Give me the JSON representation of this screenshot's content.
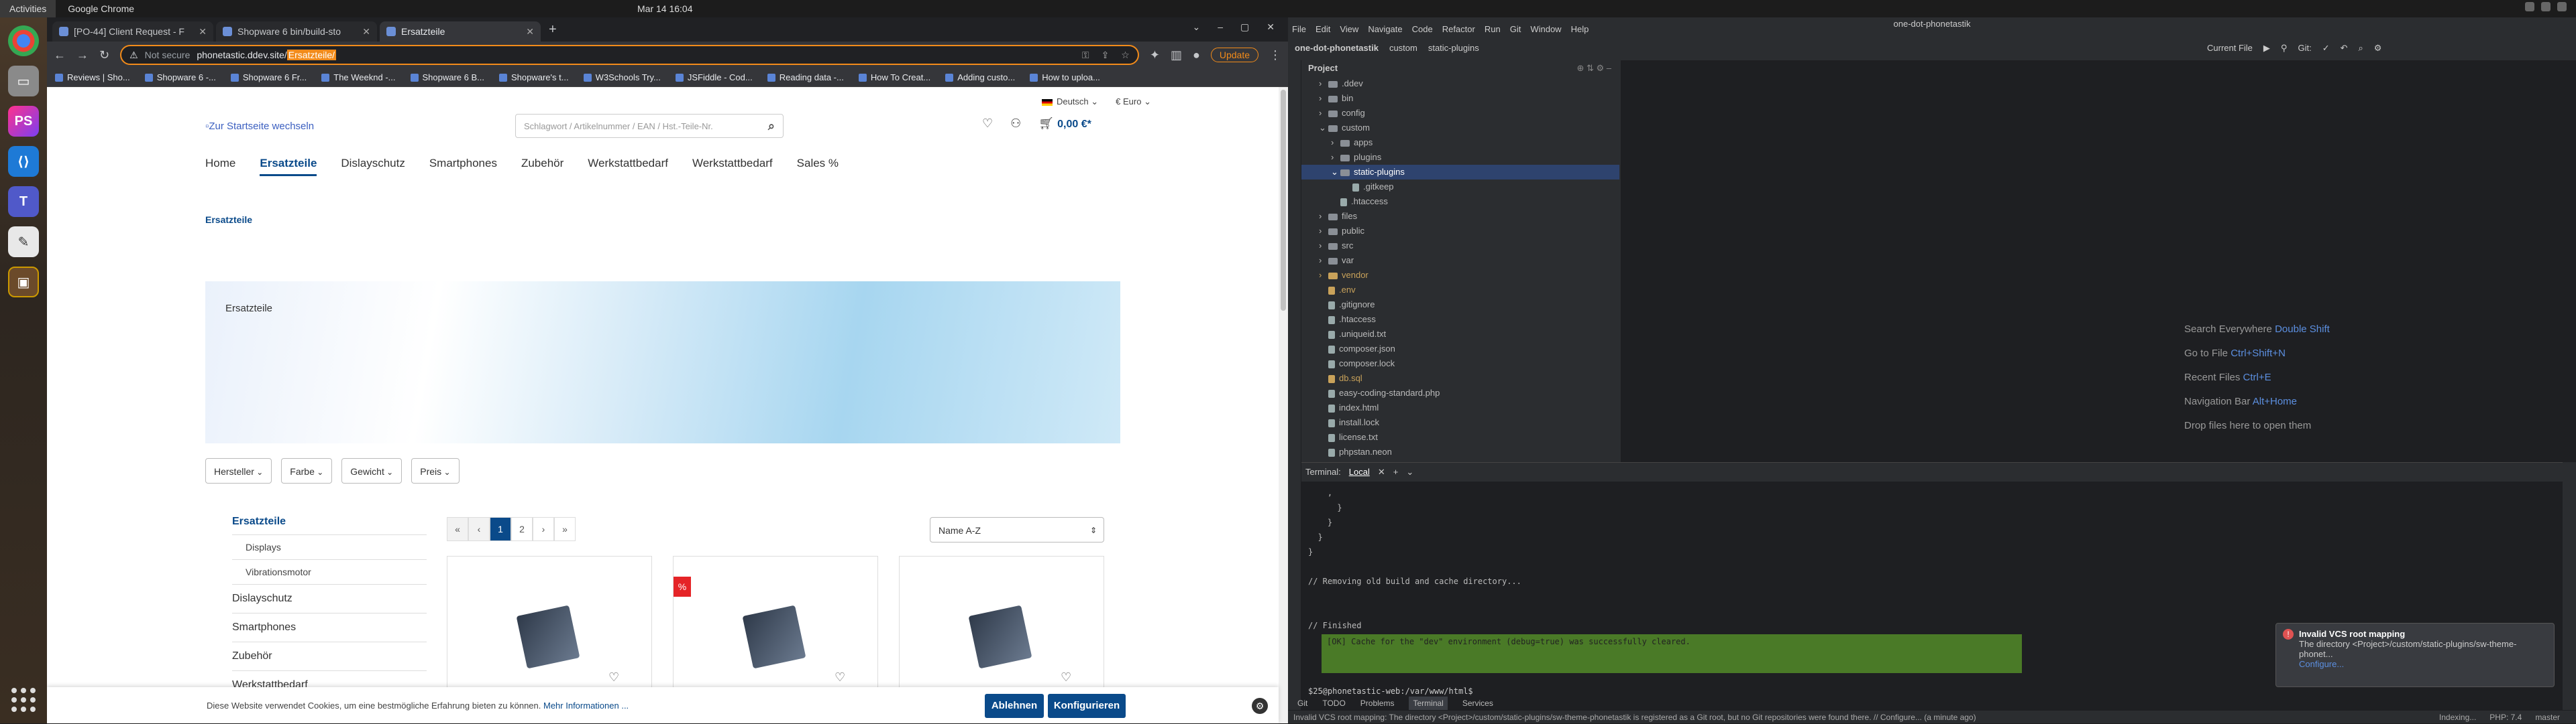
{
  "system": {
    "activities": "Activities",
    "app": "Google Chrome",
    "clock": "Mar 14  16:04"
  },
  "browser": {
    "tabs": [
      {
        "label": "[PO-44] Client Request - F"
      },
      {
        "label": "Shopware 6 bin/build-sto"
      },
      {
        "label": "Ersatzteile"
      }
    ],
    "not_secure": "Not secure",
    "url_host": "phonetastic.ddev.site/",
    "url_path": "Ersatzteile/",
    "update_label": "Update",
    "bookmarks": [
      "Reviews | Sho...",
      "Shopware 6 -...",
      "Shopware 6 Fr...",
      "The Weeknd -...",
      "Shopware 6 B...",
      "Shopware's t...",
      "W3Schools Try...",
      "JSFiddle - Cod...",
      "Reading data -...",
      "How To Creat...",
      "Adding custo...",
      "How to uploa..."
    ]
  },
  "shop": {
    "language": "Deutsch",
    "currency": "€ Euro",
    "logo_alt": "Zur Startseite wechseln",
    "search_placeholder": "Schlagwort / Artikelnummer / EAN / Hst.-Teile-Nr.",
    "cart_total": "0,00 €*",
    "nav": [
      "Home",
      "Ersatzteile",
      "Dislayschutz",
      "Smartphones",
      "Zubehör",
      "Werkstattbedarf",
      "Werkstattbedarf",
      "Sales %"
    ],
    "breadcrumb": "Ersatzteile",
    "hero_title": "Ersatzteile",
    "filters": [
      "Hersteller",
      "Farbe",
      "Gewicht",
      "Preis"
    ],
    "sidebar": {
      "active": "Ersatzteile",
      "subs": [
        "Displays",
        "Vibrationsmotor"
      ],
      "items": [
        "Dislayschutz",
        "Smartphones",
        "Zubehör",
        "Werkstattbedarf"
      ]
    },
    "pagination": [
      "«",
      "‹",
      "1",
      "2",
      "›",
      "»"
    ],
    "sort": "Name A-Z",
    "sale_badge": "%",
    "cookie_text": "Diese Website verwendet Cookies, um eine bestmögliche Erfahrung bieten zu können.",
    "cookie_link": "Mehr Informationen ...",
    "cookie_reject": "Ablehnen",
    "cookie_configure": "Konfigurieren"
  },
  "ide": {
    "title": "one-dot-phonetastik",
    "menu": [
      "File",
      "Edit",
      "View",
      "Navigate",
      "Code",
      "Refactor",
      "Run",
      "Git",
      "Window",
      "Help"
    ],
    "crumbs": [
      "one-dot-phonetastik",
      "custom",
      "static-plugins"
    ],
    "current_file": "Current File",
    "git_label": "Git:",
    "project_label": "Project",
    "tree": [
      {
        "name": ".ddev",
        "depth": 1,
        "type": "dir"
      },
      {
        "name": "bin",
        "depth": 1,
        "type": "dir"
      },
      {
        "name": "config",
        "depth": 1,
        "type": "dir"
      },
      {
        "name": "custom",
        "depth": 1,
        "type": "dir"
      },
      {
        "name": "apps",
        "depth": 2,
        "type": "dir"
      },
      {
        "name": "plugins",
        "depth": 2,
        "type": "dir"
      },
      {
        "name": "static-plugins",
        "depth": 2,
        "type": "dir",
        "selected": true
      },
      {
        "name": ".gitkeep",
        "depth": 3,
        "type": "file"
      },
      {
        "name": ".htaccess",
        "depth": 2,
        "type": "file"
      },
      {
        "name": "files",
        "depth": 1,
        "type": "dir"
      },
      {
        "name": "public",
        "depth": 1,
        "type": "dir"
      },
      {
        "name": "src",
        "depth": 1,
        "type": "dir"
      },
      {
        "name": "var",
        "depth": 1,
        "type": "dir"
      },
      {
        "name": "vendor",
        "depth": 1,
        "type": "dir",
        "orange": true
      },
      {
        "name": ".env",
        "depth": 1,
        "type": "file",
        "orange": true
      },
      {
        "name": ".gitignore",
        "depth": 1,
        "type": "file"
      },
      {
        "name": ".htaccess",
        "depth": 1,
        "type": "file"
      },
      {
        "name": ".uniqueid.txt",
        "depth": 1,
        "type": "file"
      },
      {
        "name": "composer.json",
        "depth": 1,
        "type": "file"
      },
      {
        "name": "composer.lock",
        "depth": 1,
        "type": "file"
      },
      {
        "name": "db.sql",
        "depth": 1,
        "type": "file",
        "orange": true
      },
      {
        "name": "easy-coding-standard.php",
        "depth": 1,
        "type": "file"
      },
      {
        "name": "index.html",
        "depth": 1,
        "type": "file"
      },
      {
        "name": "install.lock",
        "depth": 1,
        "type": "file"
      },
      {
        "name": "license.txt",
        "depth": 1,
        "type": "file"
      },
      {
        "name": "phpstan.neon",
        "depth": 1,
        "type": "file"
      }
    ],
    "hints": [
      {
        "label": "Search Everywhere",
        "key": "Double Shift"
      },
      {
        "label": "Go to File",
        "key": "Ctrl+Shift+N"
      },
      {
        "label": "Recent Files",
        "key": "Ctrl+E"
      },
      {
        "label": "Navigation Bar",
        "key": "Alt+Home"
      },
      {
        "label": "Drop files here to open them",
        "key": ""
      }
    ],
    "terminal": {
      "header": "Terminal:",
      "tab": "Local",
      "lines": "    ,\n      }\n    }\n  }\n}\n\n// Removing old build and cache directory...\n\n\n// Finished\n",
      "ok": "[OK] Cache for the \"dev\" environment (debug=true) was successfully cleared.",
      "prompt": "$25@phonetastic-web:/var/www/html$"
    },
    "notification": {
      "title": "Invalid VCS root mapping",
      "body": "The directory <Project>/custom/static-plugins/sw-theme-phonet...",
      "link": "Configure..."
    },
    "bottom_tools": [
      "Git",
      "TODO",
      "Problems",
      "Terminal",
      "Services"
    ],
    "status": "Invalid VCS root mapping: The directory <Project>/custom/static-plugins/sw-theme-phonetastik is registered as a Git root, but no Git repositories were found there. // Configure... (a minute ago)",
    "status_right": [
      "Indexing...",
      "PHP: 7.4",
      "master"
    ]
  }
}
